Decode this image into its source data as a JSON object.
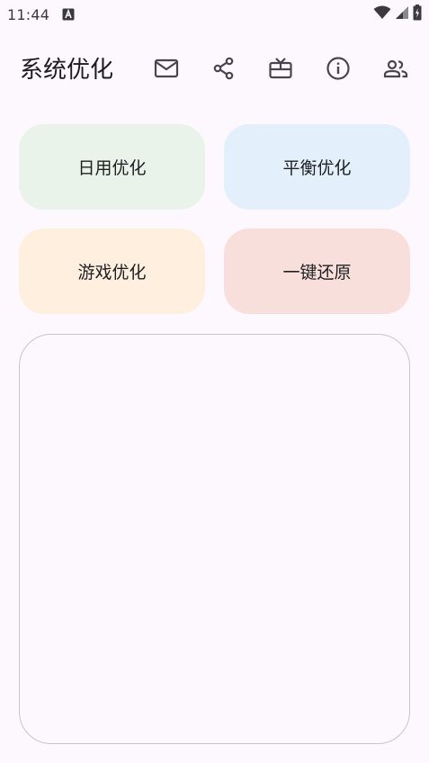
{
  "status_bar": {
    "time": "11:44"
  },
  "toolbar": {
    "title": "系统优化",
    "icons": [
      "mail-icon",
      "share-icon",
      "gift-icon",
      "info-icon",
      "people-icon"
    ]
  },
  "actions": [
    {
      "label": "日用优化",
      "color": "#E9F3E9"
    },
    {
      "label": "平衡优化",
      "color": "#E3F0FC"
    },
    {
      "label": "游戏优化",
      "color": "#FEEFDE"
    },
    {
      "label": "一键还原",
      "color": "#F9DFDC"
    }
  ],
  "colors": {
    "background": "#FDF7FE",
    "icon": "#49454F",
    "panel_border": "#C9C4CB"
  }
}
